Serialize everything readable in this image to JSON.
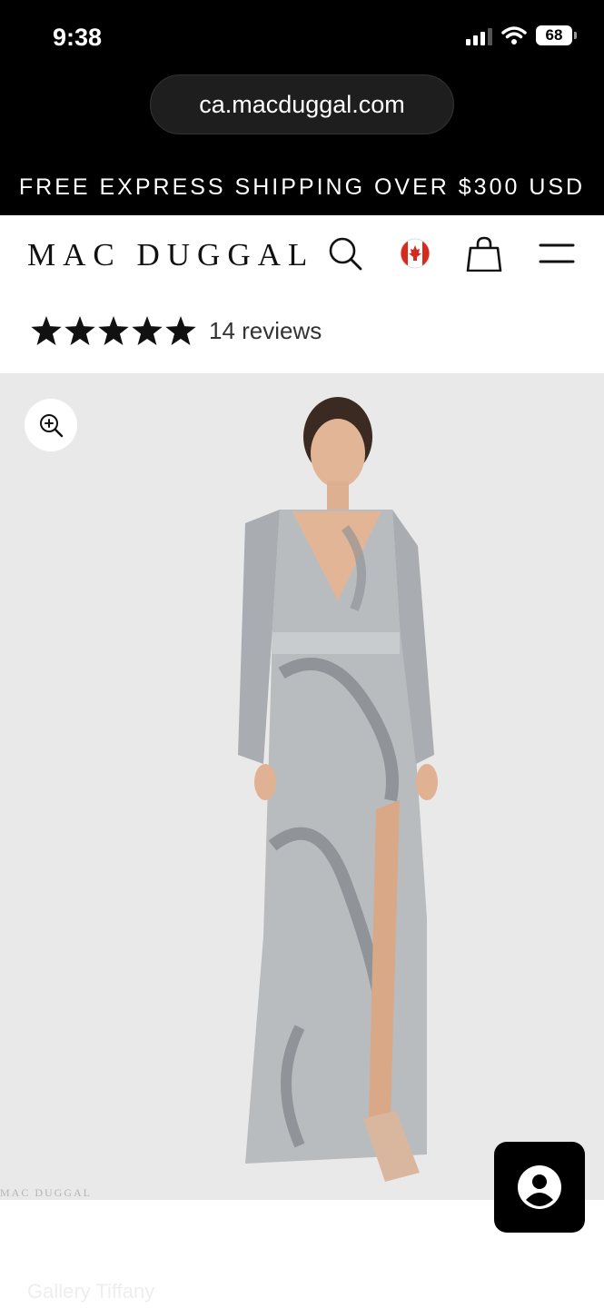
{
  "status_bar": {
    "time": "9:38",
    "battery": "68",
    "icons": [
      "signal-icon",
      "wifi-icon",
      "battery-icon"
    ]
  },
  "browser": {
    "url": "ca.macduggal.com"
  },
  "banner": {
    "text": "FREE EXPRESS SHIPPING OVER $300 USD"
  },
  "header": {
    "logo": "MAC DUGGAL",
    "icons": [
      "search-icon",
      "canada-flag-icon",
      "shopping-bag-icon",
      "menu-icon"
    ]
  },
  "reviews": {
    "rating": 5,
    "max": 5,
    "label": "14 reviews"
  },
  "product": {
    "image_alt": "Model in silver sequined long-sleeve wrap gown with thigh slit",
    "watermark": "MAC DUGGAL",
    "zoom_icon": "zoom-in-icon"
  },
  "below": {
    "faded_text": "Gallery Tiffany"
  },
  "chat": {
    "icon": "chat-user-icon"
  },
  "colors": {
    "black": "#000000",
    "image_bg": "#e9e9e9",
    "flag_red": "#d52b1e"
  }
}
